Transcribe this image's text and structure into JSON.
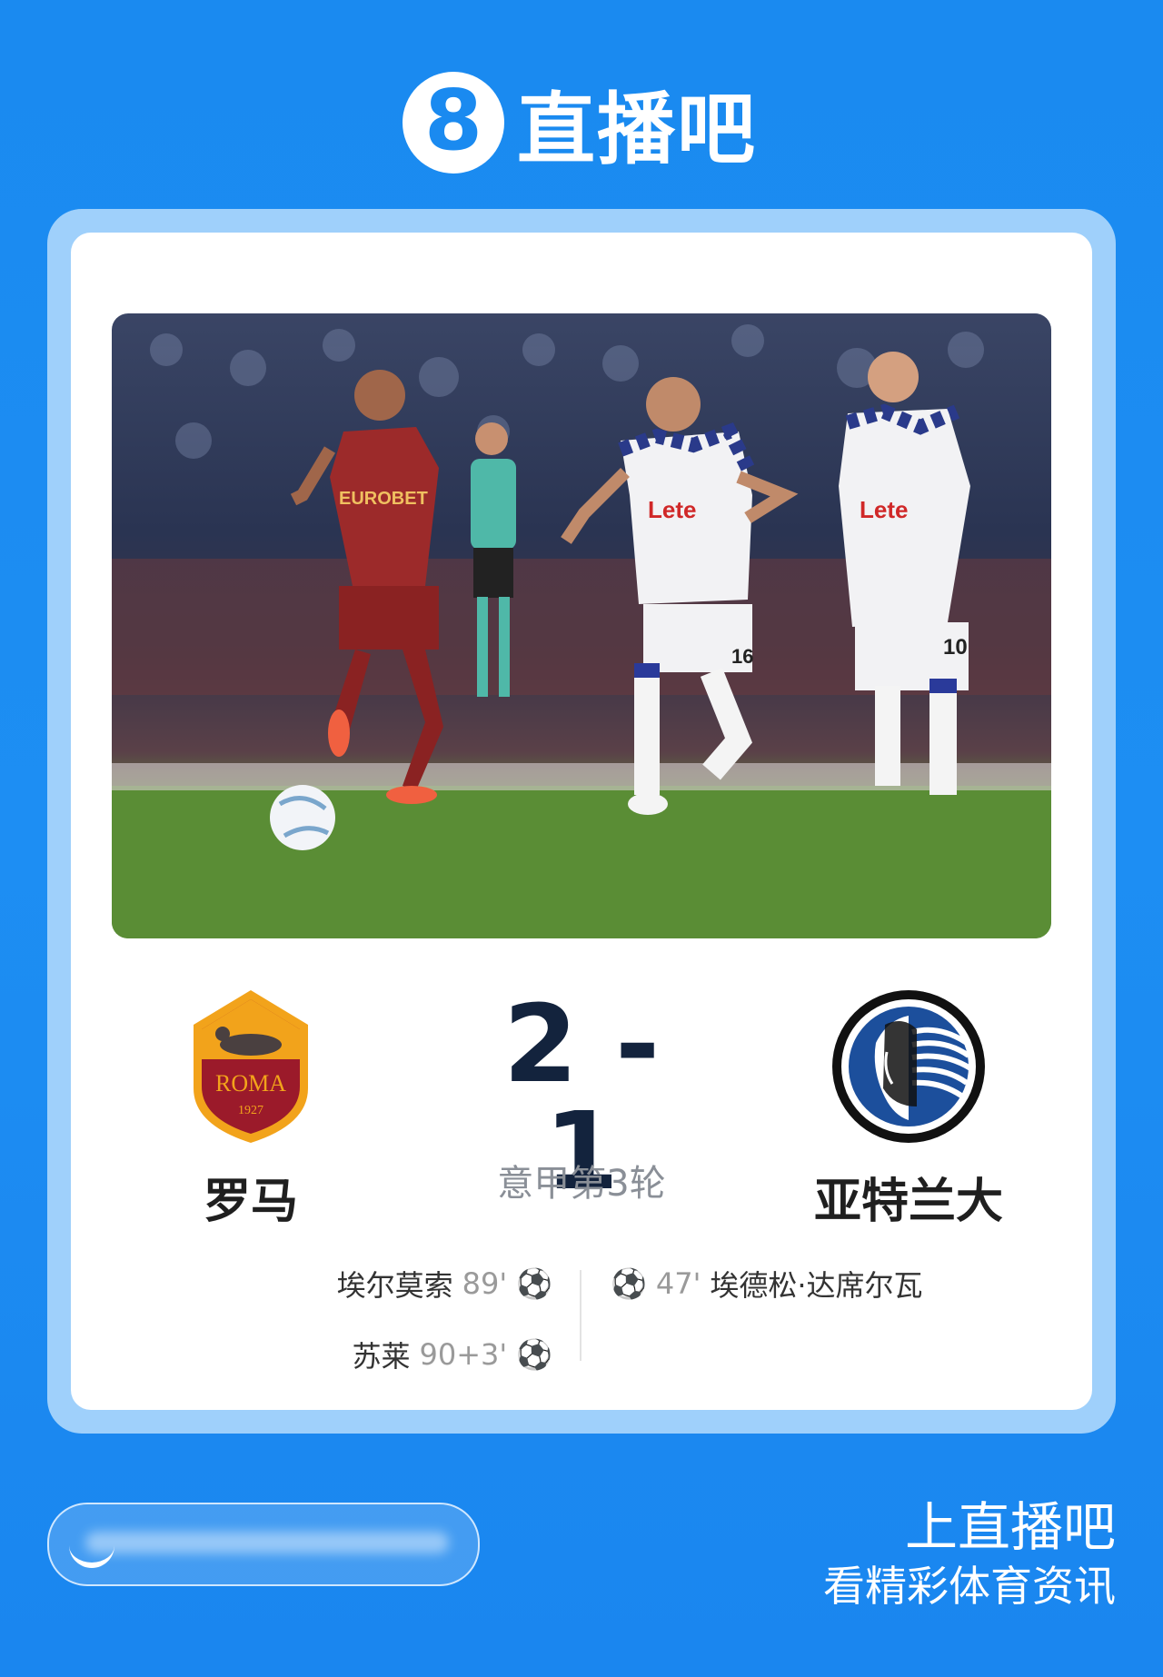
{
  "header": {
    "logo_mark": "8",
    "logo_text": "直播吧"
  },
  "match": {
    "home": {
      "name": "罗马",
      "crest_text": "ROMA",
      "crest_year": "1927"
    },
    "away": {
      "name": "亚特兰大"
    },
    "score": "2 - 1",
    "round": "意甲第3轮",
    "home_goals": [
      {
        "player": "埃尔莫索",
        "minute": "89'"
      },
      {
        "player": "苏莱",
        "minute": "90+3'"
      }
    ],
    "away_goals": [
      {
        "player": "埃德松·达席尔瓦",
        "minute": "47'"
      }
    ],
    "ball_icon": "⚽"
  },
  "photo": {
    "sponsor_home": "EUROBET",
    "sponsor_away": "Lete",
    "number_away_1": "16",
    "number_away_2": "10"
  },
  "footer": {
    "title": "上直播吧",
    "subtitle": "看精彩体育资讯"
  },
  "colors": {
    "brand_blue": "#1a8af0",
    "score_navy": "#13233d"
  }
}
